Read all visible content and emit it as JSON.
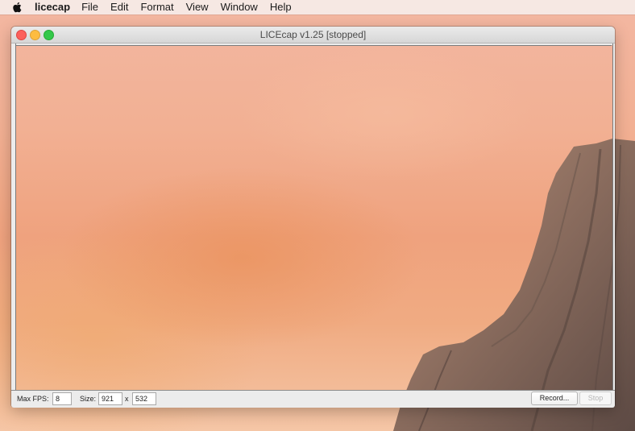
{
  "menubar": {
    "app_name": "licecap",
    "items": [
      "File",
      "Edit",
      "Format",
      "View",
      "Window",
      "Help"
    ]
  },
  "window": {
    "title": "LICEcap v1.25 [stopped]",
    "traffic_lights": [
      "close",
      "minimize",
      "zoom"
    ]
  },
  "controls": {
    "fps_label": "Max FPS:",
    "fps_value": "8",
    "size_label": "Size:",
    "width_value": "921",
    "x_label": "x",
    "height_value": "532",
    "record_label": "Record...",
    "stop_label": "Stop"
  },
  "colors": {
    "close": "#fc605c",
    "minimize": "#fdbc40",
    "zoom": "#34c84a"
  },
  "icons": {
    "apple": "apple-logo-icon"
  }
}
